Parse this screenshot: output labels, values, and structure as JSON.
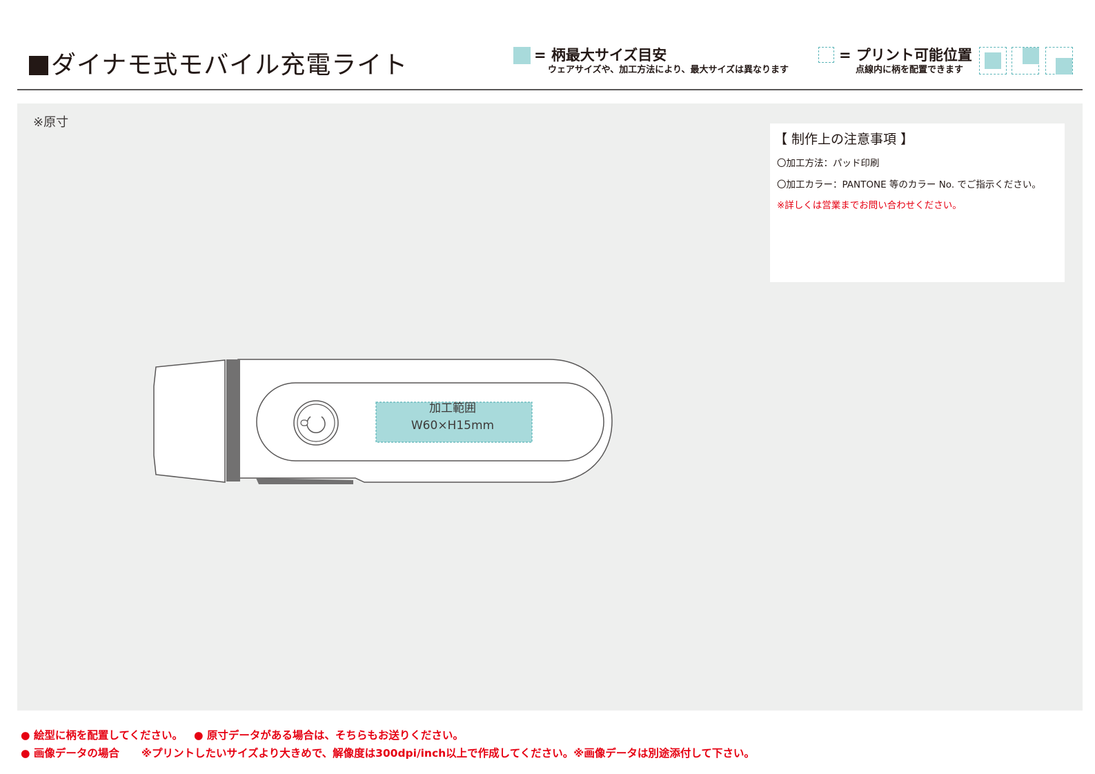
{
  "header": {
    "title": "ダイナモ式モバイル充電ライト",
    "legend_max": {
      "label": "= 柄最大サイズ目安",
      "sub": "ウェアサイズや、加工方法により、最大サイズは異なります"
    },
    "legend_print": {
      "label": "= プリント可能位置",
      "sub": "点線内に柄を配置できます"
    }
  },
  "canvas": {
    "scale_note": "※原寸",
    "print_area": {
      "label": "加工範囲",
      "size": "W60×H15mm"
    }
  },
  "notes": {
    "heading": "【 制作上の注意事項 】",
    "method": "〇加工方法：パッド印刷",
    "color": "〇加工カラー：PANTONE 等のカラー No. でご指示ください。",
    "contact": "※詳しくは営業までお問い合わせください。"
  },
  "footer": {
    "line1_a": "● 絵型に柄を配置してください。",
    "line1_b": "● 原寸データがある場合は、そちらもお送りください。",
    "line2_a": "● 画像データの場合",
    "line2_b": "※プリントしたいサイズより大きめで、解像度は300dpi/inch以上で作成してください。※画像データは別途添付して下さい。"
  },
  "colors": {
    "swatch_teal": "#a8dadb",
    "dash_teal": "#5ab5b8",
    "warning_red": "#e60012",
    "canvas_gray": "#eeefee"
  },
  "icons": [
    "power-icon"
  ]
}
